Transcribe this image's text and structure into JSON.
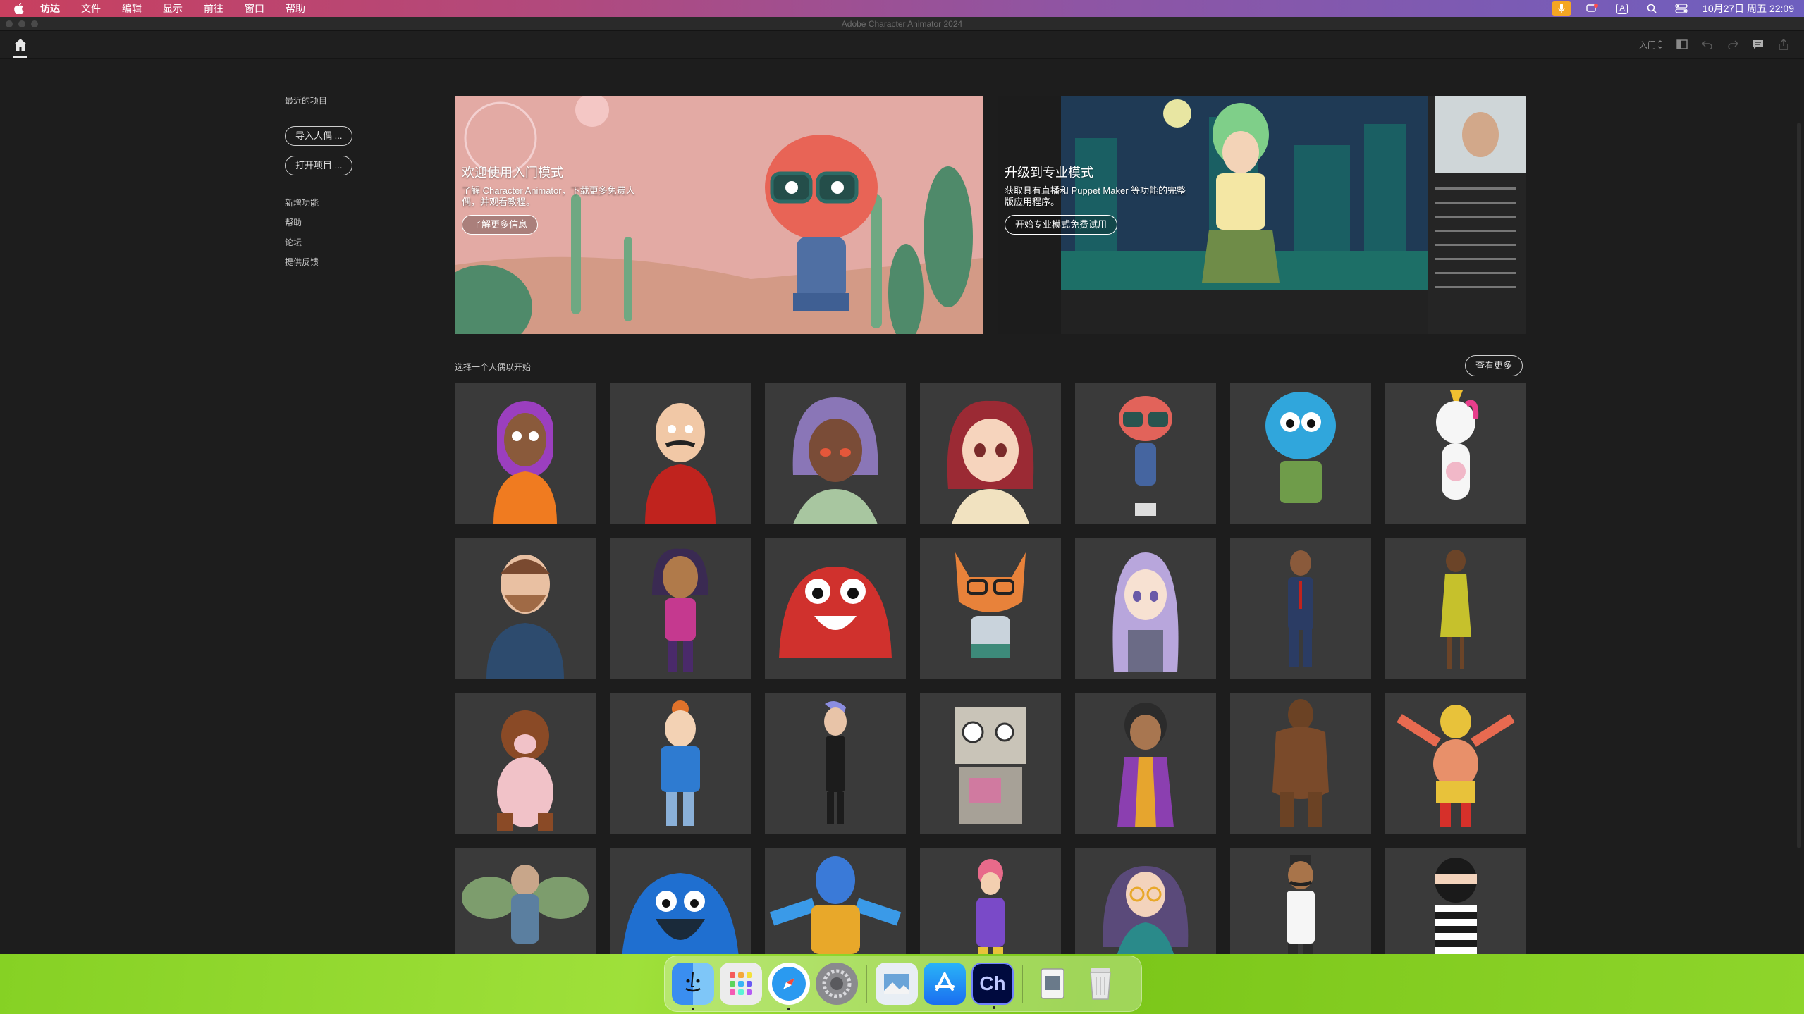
{
  "menubar": {
    "app_name": "访达",
    "items": [
      "文件",
      "编辑",
      "显示",
      "前往",
      "窗口",
      "帮助"
    ],
    "datetime": "10月27日 周五 22:09",
    "input_indicator": "A"
  },
  "window": {
    "title": "Adobe Character Animator 2024"
  },
  "toolbar": {
    "mode_label": "入门"
  },
  "sidebar": {
    "heading": "最近的项目",
    "import_button": "导入人偶 ...",
    "open_button": "打开项目 ...",
    "links": [
      "新增功能",
      "帮助",
      "论坛",
      "提供反馈"
    ]
  },
  "banners": [
    {
      "title": "欢迎使用入门模式",
      "description": "了解 Character Animator，下载更多免费人偶，并观看教程。",
      "button": "了解更多信息"
    },
    {
      "title": "升级到专业模式",
      "description": "获取具有直播和 Puppet Maker 等功能的完整版应用程序。",
      "button": "开始专业模式免费试用"
    }
  ],
  "puppets_section": {
    "label": "选择一个人偶以开始",
    "see_more": "查看更多"
  },
  "colors": {
    "accent": "#e8e8e8",
    "tile_bg": "#3a3a3a",
    "app_bg": "#1d1d1d"
  },
  "dock": {
    "apps": [
      "finder-icon",
      "launchpad-icon",
      "safari-icon",
      "system-settings-icon",
      "preview-icon",
      "app-store-icon",
      "character-animator-icon",
      "files-icon",
      "trash-icon"
    ],
    "ch_label": "Ch"
  }
}
